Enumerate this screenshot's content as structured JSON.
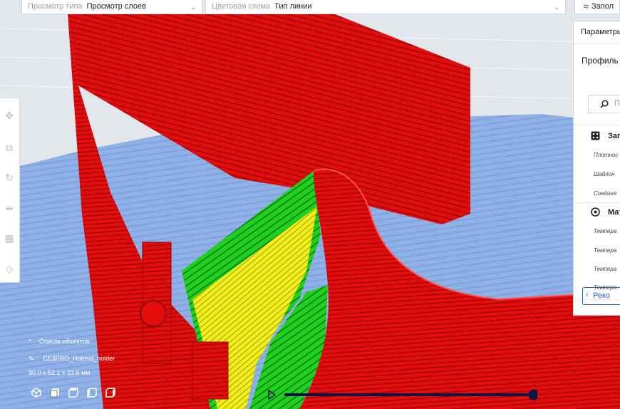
{
  "topbar": {
    "view_type_label": "Просмотр типа",
    "view_type_value": "Просмотр слоев",
    "color_scheme_label": "Цветовая схема",
    "color_scheme_value": "Тип линии",
    "right_button_label": "Запол"
  },
  "toolbar": {
    "tools": [
      "move-icon",
      "scale-icon",
      "rotate-icon",
      "mirror-icon",
      "per-model-settings-icon",
      "support-blocker-icon"
    ]
  },
  "settings_panel": {
    "header": "Параметры",
    "profile_label": "Профиль",
    "search_placeholder": "П",
    "sections": [
      {
        "title": "Запо",
        "icon": "infill-icon",
        "settings": [
          "Плотнос",
          "Шаблон",
          "Соединя"
        ]
      },
      {
        "title": "Мат",
        "icon": "material-icon",
        "settings": [
          "Темпера",
          "Темпера",
          "Темпера",
          "Темпера"
        ]
      }
    ],
    "recommended_button": "Реко"
  },
  "object_info": {
    "list_label": "Список объектов",
    "object_name": "CE3PRO_Hotend_holder",
    "dimensions": "90.0 x 52.1 x 23.6 мм"
  },
  "view_buttons": [
    "3d-view-icon",
    "front-view-icon",
    "top-view-icon",
    "left-view-icon",
    "right-view-icon"
  ],
  "layer_slider": {
    "position": 1.0
  },
  "colors": {
    "wall": "#e40d0d",
    "infill_green": "#1fd11f",
    "skin_yellow": "#f2ef1a",
    "build_plate": "#8fb1e8",
    "accent": "#2a5fd6",
    "slider": "#0c1440"
  }
}
